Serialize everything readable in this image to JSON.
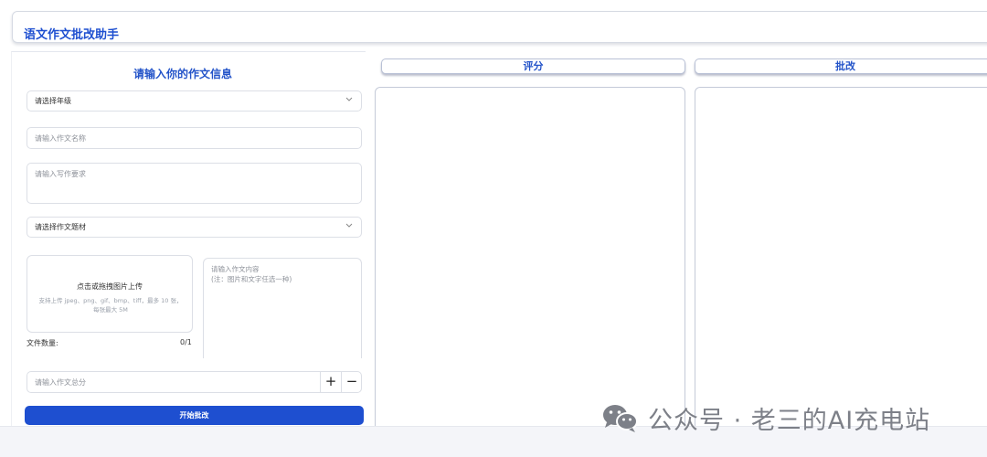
{
  "app": {
    "title": "语文作文批改助手"
  },
  "form": {
    "title": "请输入你的作文信息",
    "grade_select": "请选择年级",
    "essay_name_placeholder": "请输入作文名称",
    "requirements_placeholder": "请输入写作要求",
    "material_select": "请选择作文题材",
    "upload": {
      "title": "点击或拖拽图片上传",
      "hint": "支持上传 jpeg、png、gif、bmp、tiff，最多 10 张，每张最大 5M",
      "file_count_label": "文件数量:",
      "file_count_value": "0/1"
    },
    "content_placeholder_line1": "请输入作文内容",
    "content_placeholder_line2": "(注：图片和文字任选一种)",
    "score_placeholder": "请输入作文总分",
    "plus": "+",
    "minus": "−",
    "submit": "开始批改"
  },
  "results": {
    "score_tab": "评分",
    "review_tab": "批改"
  },
  "watermark": {
    "text": "公众号 · 老三的AI充电站",
    "icon": "wechat-icon"
  },
  "colors": {
    "accent": "#1e4fd0",
    "title": "#2454c9"
  }
}
